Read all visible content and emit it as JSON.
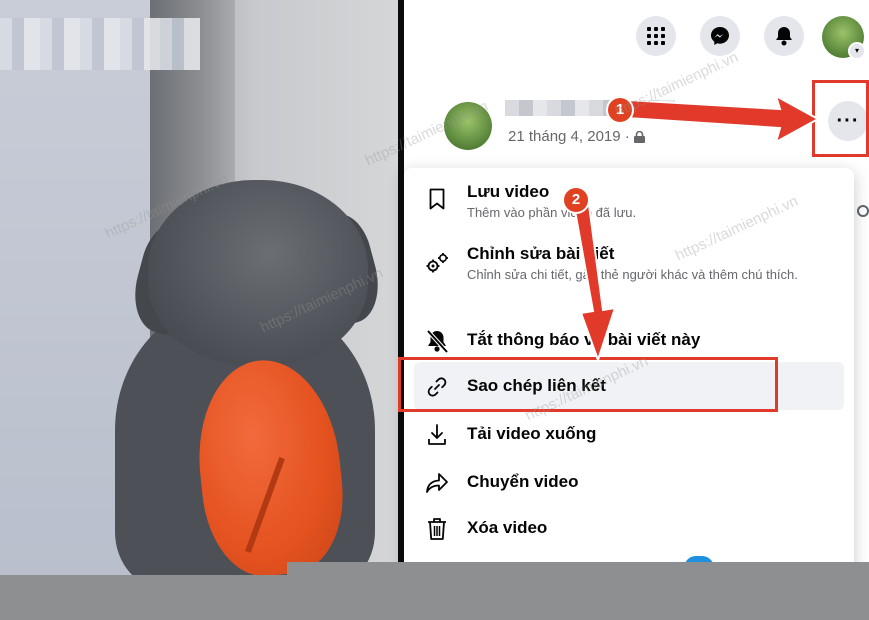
{
  "menu": {
    "items": [
      {
        "title": "Lưu video",
        "subtitle": "Thêm vào phần video đã lưu.",
        "icon": "bookmark-icon"
      },
      {
        "title": "Chỉnh sửa bài viết",
        "subtitle": "Chỉnh sửa chi tiết, gắn thẻ người khác và thêm chú thích.",
        "icon": "gears-icon"
      },
      {
        "title": "Tắt thông báo về bài viết này",
        "subtitle": "",
        "icon": "bell-off-icon"
      },
      {
        "title": "Sao chép liên kết",
        "subtitle": "",
        "icon": "link-icon"
      },
      {
        "title": "Tải video xuống",
        "subtitle": "",
        "icon": "download-icon"
      },
      {
        "title": "Chuyển video",
        "subtitle": "",
        "icon": "share-icon"
      },
      {
        "title": "Xóa video",
        "subtitle": "",
        "icon": "trash-icon"
      }
    ]
  },
  "post": {
    "date": "21 tháng 4, 2019 ·",
    "more": "···"
  },
  "badges": {
    "step1": "1",
    "step2": "2"
  },
  "watermark": "https://taimienphi.vn",
  "colors": {
    "accent_red": "#e23a2a",
    "menu_bg": "#ffffff",
    "text": "#050505",
    "muted": "#65676b"
  }
}
